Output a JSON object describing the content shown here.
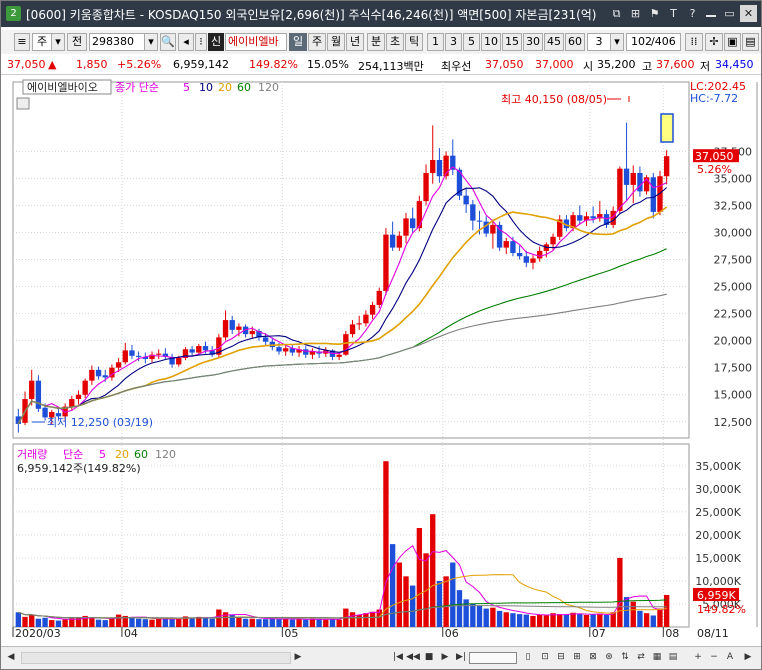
{
  "window": {
    "badge": "2",
    "title": "[0600] 키움종합차트 - KOSDAQ150 외국인보유[2,696(천)] 주식수[46,246(천)] 액면[500] 자본금[231(억)",
    "buttons": [
      "⧉",
      "⊞",
      "⚑",
      "T",
      "?",
      "",
      "▭",
      "✕"
    ]
  },
  "toolbar": {
    "period": "주",
    "jeon": "전",
    "code": "298380",
    "sin": "신",
    "stock_name": "에이비엘바",
    "intervals": [
      "일",
      "주",
      "월",
      "년",
      "분",
      "초",
      "틱"
    ],
    "selected_interval": "일",
    "numbers": [
      "1",
      "3",
      "5",
      "10",
      "15",
      "30",
      "45",
      "60"
    ],
    "count": "3",
    "page": "102",
    "page_total": "/406"
  },
  "info": {
    "price": "37,050",
    "arrow": "▲",
    "change": "1,850",
    "change_pct": "+5.26%",
    "volume": "6,959,142",
    "vol_ratio": "149.82%",
    "turnover": "15.05%",
    "amount": "254,113백만",
    "best_label": "최우선",
    "ask": "37,050",
    "bid": "37,000",
    "open_label": "시",
    "open": "35,200",
    "high_label": "고",
    "high": "37,600",
    "low_label": "저",
    "low": "34,450"
  },
  "chart_data": [
    {
      "type": "candlestick",
      "title": "에이비엘바이오",
      "legend": {
        "label": "종가 단순",
        "periods": [
          "5",
          "10",
          "20",
          "60",
          "120"
        ],
        "colors": [
          "#e000e0",
          "#000080",
          "#e0a000",
          "#008000",
          "#808080"
        ]
      },
      "y_ticks": [
        12500,
        15000,
        17500,
        20000,
        22500,
        25000,
        27500,
        30000,
        32500,
        35000,
        37500
      ],
      "ylim": [
        11000,
        42800
      ],
      "x_month_labels": [
        "2020/03",
        "04",
        "05",
        "06",
        "07",
        "08"
      ],
      "annotations": {
        "high": "최고 40,150 (08/05)",
        "low": "최저 12,250 (03/19)",
        "last_price": "37,050",
        "last_pct": "5.26%",
        "lc": "LC:202.45",
        "hc": "HC:-7.72"
      },
      "candles": [
        [
          13000,
          13700,
          11500,
          12300
        ],
        [
          12400,
          15300,
          12200,
          14600
        ],
        [
          14600,
          17300,
          14000,
          16300
        ],
        [
          16300,
          16800,
          13400,
          13700
        ],
        [
          13800,
          14200,
          12600,
          12900
        ],
        [
          12900,
          13600,
          12250,
          13400
        ],
        [
          13300,
          13800,
          12600,
          13000
        ],
        [
          13000,
          14200,
          12600,
          13900
        ],
        [
          13900,
          14900,
          13500,
          14600
        ],
        [
          14600,
          15400,
          14100,
          15000
        ],
        [
          15000,
          16500,
          14700,
          16300
        ],
        [
          16300,
          17700,
          15900,
          17300
        ],
        [
          17300,
          17600,
          16400,
          16700
        ],
        [
          16800,
          17300,
          16200,
          16600
        ],
        [
          16600,
          17800,
          16300,
          17500
        ],
        [
          17500,
          18400,
          17100,
          18000
        ],
        [
          18000,
          19800,
          17800,
          19100
        ],
        [
          19100,
          19600,
          18300,
          18600
        ],
        [
          18600,
          19000,
          18100,
          18500
        ],
        [
          18500,
          18900,
          17900,
          18300
        ],
        [
          18300,
          19000,
          18000,
          18700
        ],
        [
          18700,
          19200,
          18300,
          18800
        ],
        [
          18800,
          19300,
          18200,
          18500
        ],
        [
          18500,
          18800,
          17500,
          17800
        ],
        [
          17800,
          18600,
          17600,
          18400
        ],
        [
          18400,
          19400,
          18200,
          19200
        ],
        [
          19200,
          19500,
          18600,
          18900
        ],
        [
          18900,
          19700,
          18700,
          19500
        ],
        [
          19500,
          19900,
          18800,
          19100
        ],
        [
          19100,
          19500,
          18500,
          18700
        ],
        [
          18700,
          20600,
          18500,
          20300
        ],
        [
          20300,
          22800,
          20000,
          21900
        ],
        [
          21900,
          22300,
          20600,
          21000
        ],
        [
          21000,
          21600,
          20400,
          21300
        ],
        [
          21300,
          21500,
          20300,
          20600
        ],
        [
          20600,
          21300,
          20200,
          20900
        ],
        [
          20900,
          21100,
          20000,
          20300
        ],
        [
          20300,
          20700,
          19600,
          19900
        ],
        [
          19900,
          20300,
          19100,
          19400
        ],
        [
          19400,
          19800,
          18700,
          19000
        ],
        [
          19000,
          19600,
          18600,
          19300
        ],
        [
          19300,
          19600,
          18600,
          18900
        ],
        [
          18900,
          19500,
          18500,
          19200
        ],
        [
          19200,
          19500,
          18400,
          18700
        ],
        [
          18700,
          19300,
          18300,
          19000
        ],
        [
          19000,
          19500,
          18400,
          18800
        ],
        [
          18800,
          19400,
          18500,
          19100
        ],
        [
          19100,
          19200,
          18200,
          18500
        ],
        [
          18500,
          18900,
          18200,
          18700
        ],
        [
          18700,
          20900,
          18600,
          20600
        ],
        [
          20600,
          21900,
          20300,
          21500
        ],
        [
          21500,
          22300,
          21000,
          21600
        ],
        [
          21600,
          22800,
          21300,
          22400
        ],
        [
          22400,
          23600,
          22000,
          23300
        ],
        [
          23300,
          24900,
          23000,
          24600
        ],
        [
          24600,
          30400,
          24200,
          29800
        ],
        [
          29800,
          31000,
          28300,
          28600
        ],
        [
          28600,
          30100,
          28300,
          29700
        ],
        [
          29700,
          31800,
          29000,
          31300
        ],
        [
          31300,
          32300,
          29900,
          30400
        ],
        [
          30400,
          33400,
          30100,
          32900
        ],
        [
          32900,
          36300,
          32500,
          35500
        ],
        [
          35500,
          39900,
          34500,
          36700
        ],
        [
          36700,
          37800,
          34600,
          35200
        ],
        [
          35200,
          37500,
          34900,
          37100
        ],
        [
          37100,
          38600,
          35300,
          35800
        ],
        [
          35800,
          36000,
          33000,
          33400
        ],
        [
          33400,
          34100,
          31800,
          32600
        ],
        [
          32600,
          33000,
          30200,
          31100
        ],
        [
          31100,
          32000,
          29800,
          31000
        ],
        [
          31000,
          31500,
          29600,
          29900
        ],
        [
          29900,
          31200,
          28500,
          30700
        ],
        [
          30700,
          31000,
          28300,
          28600
        ],
        [
          28600,
          29500,
          28000,
          29200
        ],
        [
          29200,
          29600,
          27800,
          28100
        ],
        [
          28100,
          28800,
          27500,
          27800
        ],
        [
          27800,
          28300,
          26800,
          27200
        ],
        [
          27200,
          27900,
          26600,
          27600
        ],
        [
          27600,
          28700,
          27300,
          28300
        ],
        [
          28300,
          29100,
          27700,
          28900
        ],
        [
          28900,
          29900,
          28400,
          29600
        ],
        [
          29600,
          31600,
          29300,
          31200
        ],
        [
          31200,
          31600,
          30100,
          30400
        ],
        [
          30400,
          31900,
          30100,
          31600
        ],
        [
          31600,
          32500,
          30800,
          31100
        ],
        [
          31100,
          31900,
          30600,
          31500
        ],
        [
          31500,
          32400,
          30900,
          31300
        ],
        [
          31300,
          32900,
          31000,
          31700
        ],
        [
          31700,
          32100,
          30400,
          30700
        ],
        [
          30700,
          32400,
          30400,
          32000
        ],
        [
          32000,
          36100,
          31700,
          35900
        ],
        [
          35900,
          40150,
          33000,
          34400
        ],
        [
          34400,
          36200,
          32700,
          35500
        ],
        [
          35500,
          36100,
          33300,
          33800
        ],
        [
          33800,
          35300,
          33500,
          35100
        ],
        [
          35100,
          35500,
          31300,
          31900
        ],
        [
          31900,
          35700,
          31600,
          35200
        ],
        [
          35200,
          37600,
          34450,
          37050
        ]
      ],
      "y_axis_side": "right"
    },
    {
      "type": "bar",
      "title": "거래량",
      "legend": {
        "label": "단순",
        "periods": [
          "5",
          "20",
          "60",
          "120"
        ]
      },
      "volume_text": "6,959,142주(149.82%)",
      "y_ticks_label": [
        "5,000K",
        "10,000K",
        "15,000K",
        "20,000K",
        "25,000K",
        "30,000K",
        "35,000K"
      ],
      "y_ticks": [
        5000,
        10000,
        15000,
        20000,
        25000,
        30000,
        35000
      ],
      "ylim": [
        0,
        38000
      ],
      "last_label": "6,959K",
      "last_pct": "149.82%",
      "date_label": "08/11",
      "values": [
        3200,
        2200,
        2600,
        1800,
        2000,
        1500,
        1400,
        1700,
        1900,
        2100,
        2400,
        1900,
        1600,
        1500,
        1800,
        2700,
        2400,
        2100,
        1800,
        1700,
        1600,
        1800,
        1900,
        1700,
        1800,
        2300,
        2000,
        2200,
        1900,
        1800,
        3800,
        3200,
        2600,
        2200,
        1800,
        1800,
        1700,
        1700,
        1900,
        1700,
        1800,
        1600,
        1700,
        1600,
        1800,
        1700,
        1600,
        1700,
        1600,
        4000,
        3200,
        2600,
        3000,
        3300,
        3800,
        36000,
        18000,
        14000,
        11000,
        9000,
        21500,
        16000,
        24500,
        10000,
        11000,
        14000,
        8000,
        6000,
        5000,
        4600,
        4000,
        4200,
        3500,
        3200,
        3000,
        2800,
        2700,
        2400,
        2600,
        2500,
        3000,
        2800,
        2700,
        3100,
        2800,
        2600,
        2700,
        2900,
        2600,
        3200,
        15000,
        6500,
        5500,
        3500,
        3000,
        2500,
        4000,
        6959
      ]
    }
  ]
}
